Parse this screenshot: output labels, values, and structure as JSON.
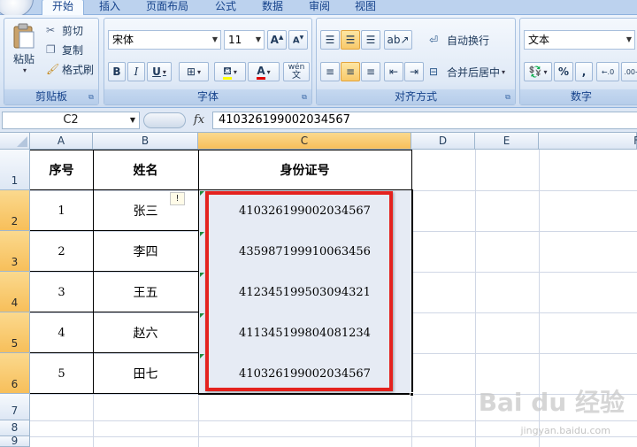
{
  "ribbon_tabs": [
    "开始",
    "插入",
    "页面布局",
    "公式",
    "数据",
    "审阅",
    "视图"
  ],
  "clipboard": {
    "paste": "粘贴",
    "cut": "剪切",
    "copy": "复制",
    "format_painter": "格式刷",
    "label": "剪贴板"
  },
  "font": {
    "name": "宋体",
    "size": "11",
    "bold": "B",
    "italic": "I",
    "underline": "U",
    "font_color": "A",
    "phonetic": "wén",
    "label": "字体"
  },
  "alignment": {
    "wrap_text": "自动换行",
    "merge_center": "合并后居中",
    "label": "对齐方式"
  },
  "number": {
    "format": "文本",
    "percent": "%",
    "comma": ",",
    "label": "数字"
  },
  "formula_bar": {
    "name_box": "C2",
    "fx": "fx",
    "value": "410326199002034567"
  },
  "columns": [
    "A",
    "B",
    "C",
    "D",
    "E",
    "F"
  ],
  "rows": [
    "1",
    "2",
    "3",
    "4",
    "5",
    "6",
    "7",
    "8",
    "9"
  ],
  "table": {
    "headers": [
      "序号",
      "姓名",
      "身份证号"
    ],
    "rows": [
      [
        "1",
        "张三",
        "410326199002034567"
      ],
      [
        "2",
        "李四",
        "435987199910063456"
      ],
      [
        "3",
        "王五",
        "412345199503094321"
      ],
      [
        "4",
        "赵六",
        "411345199804081234"
      ],
      [
        "5",
        "田七",
        "410326199002034567"
      ]
    ]
  },
  "warning_glyph": "!",
  "watermark": {
    "main": "Bai du 经验",
    "sub": "jingyan.baidu.com"
  },
  "colors": {
    "selection_border": "#000000",
    "highlight": "#e4221e",
    "header_selected": "#f7bf5a"
  }
}
